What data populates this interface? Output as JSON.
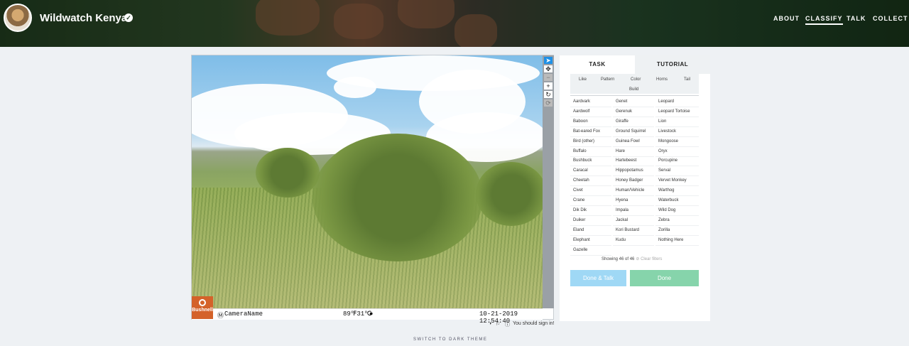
{
  "header": {
    "project_title": "Wildwatch Kenya",
    "nav": [
      "ABOUT",
      "CLASSIFY",
      "TALK",
      "COLLECT"
    ],
    "active_nav": "CLASSIFY"
  },
  "viewer": {
    "stamp": {
      "camera": "CameraName",
      "temp": "89℉31℃",
      "datetime": "10-21-2019 12:54:40",
      "brand": "Bushnell"
    },
    "status_text": "You should sign in!"
  },
  "task": {
    "tabs": [
      "TASK",
      "TUTORIAL"
    ],
    "filters": [
      "Like",
      "Pattern",
      "Color",
      "Horns",
      "Tail",
      "Build"
    ],
    "choices": [
      "Aardvark",
      "Genet",
      "Leopard",
      "Aardwolf",
      "Gerenuk",
      "Leopard Tortoise",
      "Baboon",
      "Giraffe",
      "Lion",
      "Bat-eared Fox",
      "Ground Squirrel",
      "Livestock",
      "Bird (other)",
      "Guinea Fowl",
      "Mongoose",
      "Buffalo",
      "Hare",
      "Oryx",
      "Bushbuck",
      "Hartebeest",
      "Porcupine",
      "Caracal",
      "Hippopotamus",
      "Serval",
      "Cheetah",
      "Honey Badger",
      "Vervet Monkey",
      "Civet",
      "Human/Vehicle",
      "Warthog",
      "Crane",
      "Hyena",
      "Waterbuck",
      "Dik Dik",
      "Impala",
      "Wild Dog",
      "Duiker",
      "Jackal",
      "Zebra",
      "Eland",
      "Kori Bustard",
      "Zorilla",
      "Elephant",
      "Kudu",
      "Nothing Here",
      "Gazelle"
    ],
    "showing": "Showing 46 of 46",
    "clear_filters": "Clear filters",
    "done_talk": "Done & Talk",
    "done": "Done"
  },
  "footer": {
    "theme_toggle": "SWITCH TO DARK THEME"
  },
  "colors": {
    "done_talk_bg": "#9fd8f5",
    "done_bg": "#86d4ab",
    "active_tool": "#1e90e6",
    "bushnell_logo": "#d4622a"
  }
}
